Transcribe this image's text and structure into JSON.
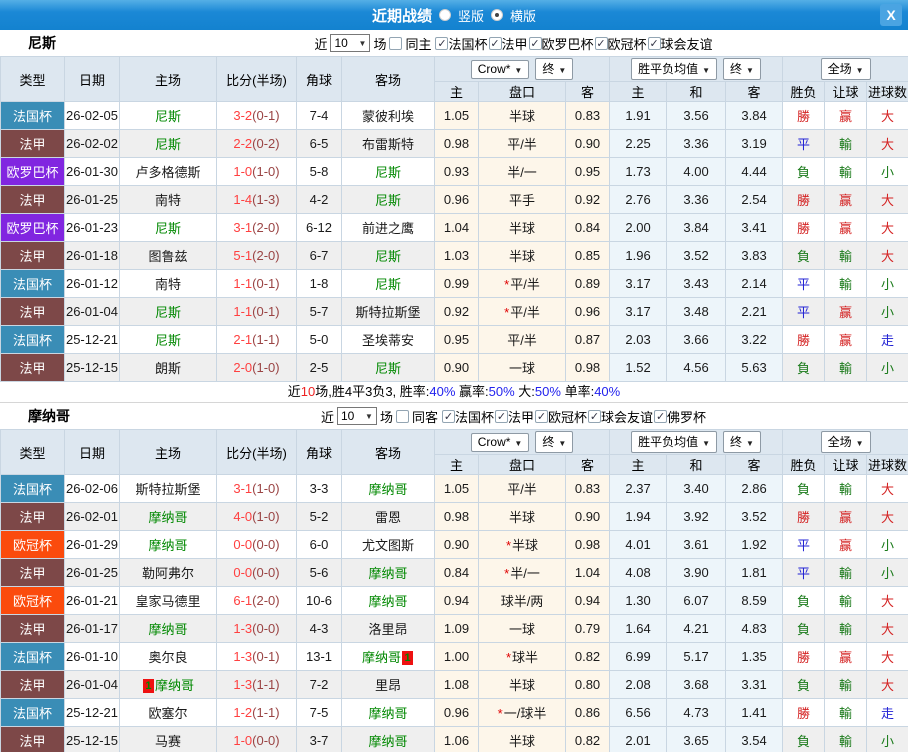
{
  "glyphs": {
    "caret": "▼",
    "check": "✓",
    "star": "*",
    "close": "X"
  },
  "titlebar": {
    "title": "近期战绩",
    "radio_vertical": "竖版",
    "radio_horizontal": "横版",
    "selected": "横版"
  },
  "labels": {
    "near": "近",
    "unit": "场"
  },
  "table": {
    "main_headers": [
      "类型",
      "日期",
      "主场",
      "比分(半场)",
      "角球",
      "客场"
    ],
    "price_dropdown": "Crow*",
    "final_dropdown": "终",
    "avg_dropdown": "胜平负均值",
    "scope_dropdown": "全场",
    "sub_headers": [
      "主",
      "盘口",
      "客",
      "主",
      "和",
      "客",
      "胜负",
      "让球",
      "进球数"
    ]
  },
  "league_colors": {
    "法国杯": "#3a8db6",
    "法甲": "#7d4848",
    "欧罗巴杯": "#8126e0",
    "欧冠杯": "#fb4b0d"
  },
  "result_colors": {
    "勝": "#d42222",
    "平": "#2222d4",
    "負": "#1a7a1a",
    "赢": "#d42222",
    "輸": "#1a7a1a",
    "走": "#2222d4",
    "大": "#d42222",
    "小": "#1a7a1a"
  },
  "sections": [
    {
      "team": "尼斯",
      "filter": {
        "count": "10",
        "same_label": "同主",
        "same_checked": false,
        "leagues": [
          "法国杯",
          "法甲",
          "欧罗巴杯",
          "欧冠杯",
          "球会友谊"
        ]
      },
      "rows": [
        {
          "league": "法国杯",
          "date": "26-02-05",
          "home": "尼斯",
          "home_subject": true,
          "score": "3-2",
          "half": "(0-1)",
          "corner": "7-4",
          "away": "蒙彼利埃",
          "away_subject": false,
          "odds_home": "1.05",
          "handicap": "半球",
          "odds_away": "0.83",
          "avg_home": "1.91",
          "avg_draw": "3.56",
          "avg_away": "3.84",
          "res_wdl": "勝",
          "res_handicap": "赢",
          "res_goals": "大"
        },
        {
          "league": "法甲",
          "date": "26-02-02",
          "home": "尼斯",
          "home_subject": true,
          "score": "2-2",
          "half": "(0-2)",
          "corner": "6-5",
          "away": "布雷斯特",
          "away_subject": false,
          "odds_home": "0.98",
          "handicap": "平/半",
          "odds_away": "0.90",
          "avg_home": "2.25",
          "avg_draw": "3.36",
          "avg_away": "3.19",
          "res_wdl": "平",
          "res_handicap": "輸",
          "res_goals": "大"
        },
        {
          "league": "欧罗巴杯",
          "date": "26-01-30",
          "home": "卢多格德斯",
          "home_subject": false,
          "score": "1-0",
          "half": "(1-0)",
          "corner": "5-8",
          "away": "尼斯",
          "away_subject": true,
          "odds_home": "0.93",
          "handicap": "半/一",
          "odds_away": "0.95",
          "avg_home": "1.73",
          "avg_draw": "4.00",
          "avg_away": "4.44",
          "res_wdl": "負",
          "res_handicap": "輸",
          "res_goals": "小"
        },
        {
          "league": "法甲",
          "date": "26-01-25",
          "home": "南特",
          "home_subject": false,
          "score": "1-4",
          "half": "(1-3)",
          "corner": "4-2",
          "away": "尼斯",
          "away_subject": true,
          "odds_home": "0.96",
          "handicap": "平手",
          "odds_away": "0.92",
          "avg_home": "2.76",
          "avg_draw": "3.36",
          "avg_away": "2.54",
          "res_wdl": "勝",
          "res_handicap": "赢",
          "res_goals": "大"
        },
        {
          "league": "欧罗巴杯",
          "date": "26-01-23",
          "home": "尼斯",
          "home_subject": true,
          "score": "3-1",
          "half": "(2-0)",
          "corner": "6-12",
          "away": "前进之鹰",
          "away_subject": false,
          "odds_home": "1.04",
          "handicap": "半球",
          "odds_away": "0.84",
          "avg_home": "2.00",
          "avg_draw": "3.84",
          "avg_away": "3.41",
          "res_wdl": "勝",
          "res_handicap": "赢",
          "res_goals": "大"
        },
        {
          "league": "法甲",
          "date": "26-01-18",
          "home": "图鲁兹",
          "home_subject": false,
          "score": "5-1",
          "half": "(2-0)",
          "corner": "6-7",
          "away": "尼斯",
          "away_subject": true,
          "odds_home": "1.03",
          "handicap": "半球",
          "odds_away": "0.85",
          "avg_home": "1.96",
          "avg_draw": "3.52",
          "avg_away": "3.83",
          "res_wdl": "負",
          "res_handicap": "輸",
          "res_goals": "大"
        },
        {
          "league": "法国杯",
          "date": "26-01-12",
          "home": "南特",
          "home_subject": false,
          "score": "1-1",
          "half": "(0-1)",
          "corner": "1-8",
          "away": "尼斯",
          "away_subject": true,
          "odds_home": "0.99",
          "handicap": "平/半",
          "handicap_star": true,
          "odds_away": "0.89",
          "avg_home": "3.17",
          "avg_draw": "3.43",
          "avg_away": "2.14",
          "res_wdl": "平",
          "res_handicap": "輸",
          "res_goals": "小"
        },
        {
          "league": "法甲",
          "date": "26-01-04",
          "home": "尼斯",
          "home_subject": true,
          "score": "1-1",
          "half": "(0-1)",
          "corner": "5-7",
          "away": "斯特拉斯堡",
          "away_subject": false,
          "odds_home": "0.92",
          "handicap": "平/半",
          "handicap_star": true,
          "odds_away": "0.96",
          "avg_home": "3.17",
          "avg_draw": "3.48",
          "avg_away": "2.21",
          "res_wdl": "平",
          "res_handicap": "赢",
          "res_goals": "小"
        },
        {
          "league": "法国杯",
          "date": "25-12-21",
          "home": "尼斯",
          "home_subject": true,
          "score": "2-1",
          "half": "(1-1)",
          "corner": "5-0",
          "away": "圣埃蒂安",
          "away_subject": false,
          "odds_home": "0.95",
          "handicap": "平/半",
          "odds_away": "0.87",
          "avg_home": "2.03",
          "avg_draw": "3.66",
          "avg_away": "3.22",
          "res_wdl": "勝",
          "res_handicap": "赢",
          "res_goals": "走"
        },
        {
          "league": "法甲",
          "date": "25-12-15",
          "home": "朗斯",
          "home_subject": false,
          "score": "2-0",
          "half": "(1-0)",
          "corner": "2-5",
          "away": "尼斯",
          "away_subject": true,
          "odds_home": "0.90",
          "handicap": "一球",
          "odds_away": "0.98",
          "avg_home": "1.52",
          "avg_draw": "4.56",
          "avg_away": "5.63",
          "res_wdl": "負",
          "res_handicap": "輸",
          "res_goals": "小"
        }
      ],
      "summary_parts": [
        {
          "t": "近",
          "c": "k"
        },
        {
          "t": "10",
          "c": "r"
        },
        {
          "t": "场,胜4平3负3, 胜率:",
          "c": "k"
        },
        {
          "t": "40%",
          "c": "b"
        },
        {
          "t": " 赢率:",
          "c": "k"
        },
        {
          "t": "50%",
          "c": "b"
        },
        {
          "t": " 大:",
          "c": "k"
        },
        {
          "t": "50%",
          "c": "b"
        },
        {
          "t": " 单率:",
          "c": "k"
        },
        {
          "t": "40%",
          "c": "b"
        }
      ]
    },
    {
      "team": "摩纳哥",
      "filter": {
        "count": "10",
        "same_label": "同客",
        "same_checked": false,
        "leagues": [
          "法国杯",
          "法甲",
          "欧冠杯",
          "球会友谊",
          "佛罗杯"
        ]
      },
      "rows": [
        {
          "league": "法国杯",
          "date": "26-02-06",
          "home": "斯特拉斯堡",
          "home_subject": false,
          "score": "3-1",
          "half": "(1-0)",
          "corner": "3-3",
          "away": "摩纳哥",
          "away_subject": true,
          "odds_home": "1.05",
          "handicap": "平/半",
          "odds_away": "0.83",
          "avg_home": "2.37",
          "avg_draw": "3.40",
          "avg_away": "2.86",
          "res_wdl": "負",
          "res_handicap": "輸",
          "res_goals": "大"
        },
        {
          "league": "法甲",
          "date": "26-02-01",
          "home": "摩纳哥",
          "home_subject": true,
          "score": "4-0",
          "half": "(1-0)",
          "corner": "5-2",
          "away": "雷恩",
          "away_subject": false,
          "odds_home": "0.98",
          "handicap": "半球",
          "odds_away": "0.90",
          "avg_home": "1.94",
          "avg_draw": "3.92",
          "avg_away": "3.52",
          "res_wdl": "勝",
          "res_handicap": "赢",
          "res_goals": "大"
        },
        {
          "league": "欧冠杯",
          "date": "26-01-29",
          "home": "摩纳哥",
          "home_subject": true,
          "score": "0-0",
          "half": "(0-0)",
          "corner": "6-0",
          "away": "尤文图斯",
          "away_subject": false,
          "odds_home": "0.90",
          "handicap": "半球",
          "handicap_star": true,
          "odds_away": "0.98",
          "avg_home": "4.01",
          "avg_draw": "3.61",
          "avg_away": "1.92",
          "res_wdl": "平",
          "res_handicap": "赢",
          "res_goals": "小"
        },
        {
          "league": "法甲",
          "date": "26-01-25",
          "home": "勒阿弗尔",
          "home_subject": false,
          "score": "0-0",
          "half": "(0-0)",
          "corner": "5-6",
          "away": "摩纳哥",
          "away_subject": true,
          "odds_home": "0.84",
          "handicap": "半/一",
          "handicap_star": true,
          "odds_away": "1.04",
          "avg_home": "4.08",
          "avg_draw": "3.90",
          "avg_away": "1.81",
          "res_wdl": "平",
          "res_handicap": "輸",
          "res_goals": "小"
        },
        {
          "league": "欧冠杯",
          "date": "26-01-21",
          "home": "皇家马德里",
          "home_subject": false,
          "score": "6-1",
          "half": "(2-0)",
          "corner": "10-6",
          "away": "摩纳哥",
          "away_subject": true,
          "odds_home": "0.94",
          "handicap": "球半/两",
          "odds_away": "0.94",
          "avg_home": "1.30",
          "avg_draw": "6.07",
          "avg_away": "8.59",
          "res_wdl": "負",
          "res_handicap": "輸",
          "res_goals": "大"
        },
        {
          "league": "法甲",
          "date": "26-01-17",
          "home": "摩纳哥",
          "home_subject": true,
          "score": "1-3",
          "half": "(0-0)",
          "corner": "4-3",
          "away": "洛里昂",
          "away_subject": false,
          "odds_home": "1.09",
          "handicap": "一球",
          "odds_away": "0.79",
          "avg_home": "1.64",
          "avg_draw": "4.21",
          "avg_away": "4.83",
          "res_wdl": "負",
          "res_handicap": "輸",
          "res_goals": "大"
        },
        {
          "league": "法国杯",
          "date": "26-01-10",
          "home": "奥尔良",
          "home_subject": false,
          "score": "1-3",
          "half": "(0-1)",
          "corner": "13-1",
          "away": "摩纳哥",
          "away_subject": true,
          "away_rc": "1",
          "away_rc_pos": "after",
          "odds_home": "1.00",
          "handicap": "球半",
          "handicap_star": true,
          "odds_away": "0.82",
          "avg_home": "6.99",
          "avg_draw": "5.17",
          "avg_away": "1.35",
          "res_wdl": "勝",
          "res_handicap": "赢",
          "res_goals": "大"
        },
        {
          "league": "法甲",
          "date": "26-01-04",
          "home": "摩纳哥",
          "home_subject": true,
          "home_rc": "1",
          "home_rc_pos": "before",
          "score": "1-3",
          "half": "(1-1)",
          "corner": "7-2",
          "away": "里昂",
          "away_subject": false,
          "odds_home": "1.08",
          "handicap": "半球",
          "odds_away": "0.80",
          "avg_home": "2.08",
          "avg_draw": "3.68",
          "avg_away": "3.31",
          "res_wdl": "負",
          "res_handicap": "輸",
          "res_goals": "大"
        },
        {
          "league": "法国杯",
          "date": "25-12-21",
          "home": "欧塞尔",
          "home_subject": false,
          "score": "1-2",
          "half": "(1-1)",
          "corner": "7-5",
          "away": "摩纳哥",
          "away_subject": true,
          "odds_home": "0.96",
          "handicap": "一/球半",
          "handicap_star": true,
          "odds_away": "0.86",
          "avg_home": "6.56",
          "avg_draw": "4.73",
          "avg_away": "1.41",
          "res_wdl": "勝",
          "res_handicap": "輸",
          "res_goals": "走"
        },
        {
          "league": "法甲",
          "date": "25-12-15",
          "home": "马赛",
          "home_subject": false,
          "score": "1-0",
          "half": "(0-0)",
          "corner": "3-7",
          "away": "摩纳哥",
          "away_subject": true,
          "odds_home": "1.06",
          "handicap": "半球",
          "odds_away": "0.82",
          "avg_home": "2.01",
          "avg_draw": "3.65",
          "avg_away": "3.54",
          "res_wdl": "負",
          "res_handicap": "輸",
          "res_goals": "小"
        }
      ]
    }
  ]
}
